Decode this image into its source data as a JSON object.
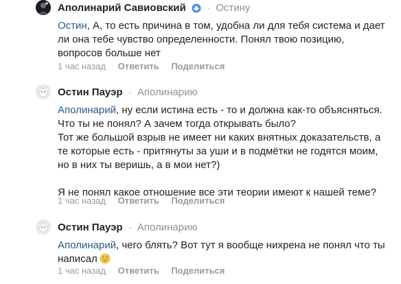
{
  "comments": [
    {
      "author": "Аполинарий Савиовский",
      "separator": "·",
      "reply_to": "Остину",
      "mention": "Остин",
      "text": ", А, то есть причина в том, удобна ли для тебя система и дает ли она тебе чувство определенности. Понял твою позицию, вопросов больше нет",
      "time": "1 час назад",
      "reply_label": "Ответить",
      "share_label": "Поделиться"
    },
    {
      "author": "Остин Пауэр",
      "separator": "·",
      "reply_to": "Аполинарию",
      "mention": "Аполинарий",
      "text_1": ", ну если истина есть - то и должна как-то объясняться. Что ты не понял? А зачем тогда открывать было?",
      "text_2": "Тот же большой взрыв не имеет ни каких внятных доказательств, а те которые есть - притянуты за уши и в подмётки не годятся моим, но в них ты веришь, а в мои нет?)",
      "text_3": "Я не понял какое отношение все эти теории имеют к нашей теме?",
      "time": "1 час назад",
      "reply_label": "Ответить",
      "share_label": "Поделиться"
    },
    {
      "author": "Остин Пауэр",
      "separator": "·",
      "reply_to": "Аполинарию",
      "mention": "Аполинарий",
      "text": ", чего блять? Вот тут я вообще нихрена не понял что ты написал",
      "time": "1 час назад",
      "reply_label": "Ответить",
      "share_label": "Поделиться"
    }
  ],
  "colors": {
    "link": "#2a5885",
    "meta": "#939aa0",
    "text": "#222222"
  },
  "icons": {
    "verified_badge": "blue-badge-icon",
    "smile": "grinning-sweat-emoji"
  }
}
